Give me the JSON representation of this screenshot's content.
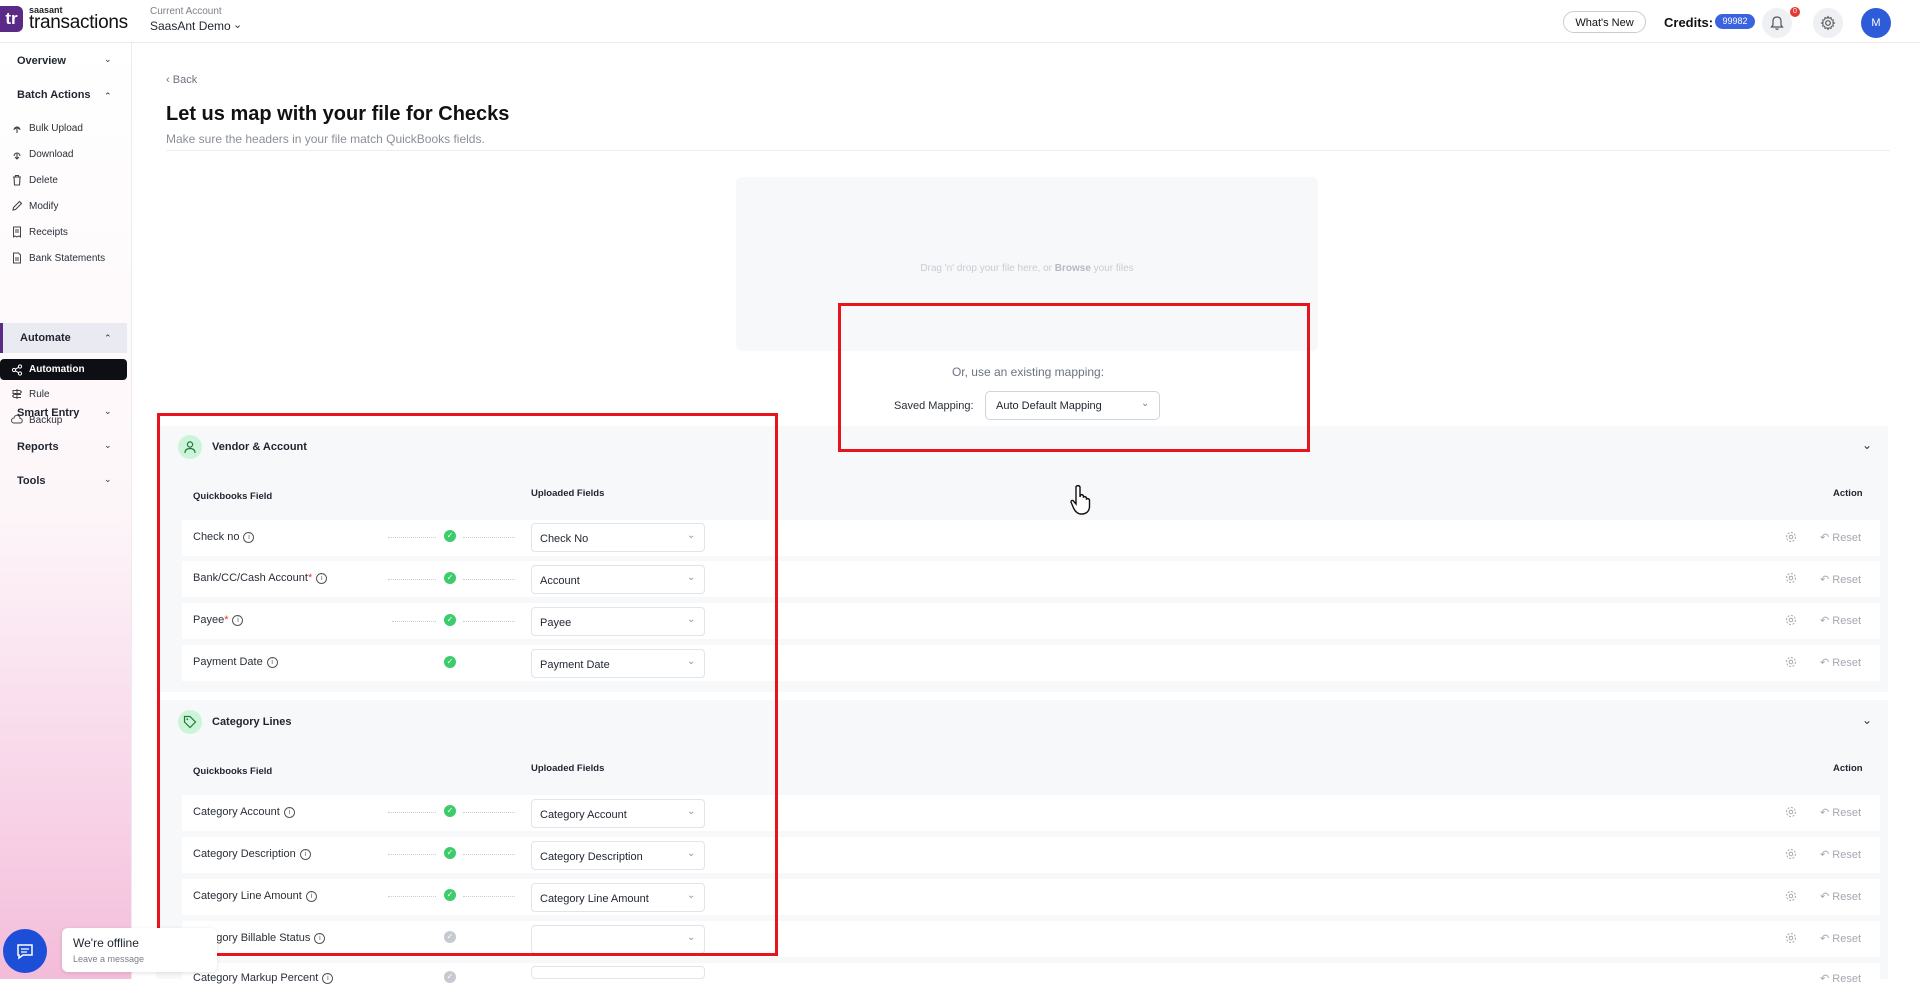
{
  "header": {
    "logo_mark": "tr",
    "logo_small": "saasant",
    "logo_big": "transactions",
    "account_caption": "Current Account",
    "account_name": "SaasAnt Demo",
    "whats_new": "What's New",
    "credits_label": "Credits:",
    "credits_value": "99982",
    "notification_count": "0",
    "avatar_initial": "M"
  },
  "sidebar": {
    "overview": "Overview",
    "batch_actions": "Batch Actions",
    "batch_items": [
      "Bulk Upload",
      "Download",
      "Delete",
      "Modify",
      "Receipts",
      "Bank Statements"
    ],
    "automate": "Automate",
    "automate_items": [
      "Automation",
      "Rule",
      "Backup"
    ],
    "smart_entry": "Smart Entry",
    "reports": "Reports",
    "tools": "Tools"
  },
  "main": {
    "back": "Back",
    "title": "Let us map with your file for Checks",
    "subtitle": "Make sure the headers in your file match QuickBooks fields.",
    "dropzone_before": "Drag 'n' drop your file here, or ",
    "dropzone_browse": "Browse",
    "dropzone_after": " your files",
    "existing_caption": "Or, use an existing mapping:",
    "saved_mapping_label": "Saved Mapping:",
    "saved_mapping_value": "Auto Default Mapping"
  },
  "sections": [
    {
      "title": "Vendor & Account",
      "col_qb": "Quickbooks Field",
      "col_uploaded": "Uploaded Fields",
      "col_action": "Action",
      "rows": [
        {
          "label": "Check no",
          "required": "",
          "value": "Check No",
          "mapped": true
        },
        {
          "label": "Bank/CC/Cash Account",
          "required": "*",
          "value": "Account",
          "mapped": true
        },
        {
          "label": "Payee",
          "required": "*",
          "value": "Payee",
          "mapped": true
        },
        {
          "label": "Payment Date",
          "required": "",
          "value": "Payment Date",
          "mapped": true
        }
      ]
    },
    {
      "title": "Category Lines",
      "col_qb": "Quickbooks Field",
      "col_uploaded": "Uploaded Fields",
      "col_action": "Action",
      "rows": [
        {
          "label": "Category Account",
          "required": "",
          "value": "Category Account",
          "mapped": true
        },
        {
          "label": "Category Description",
          "required": "",
          "value": "Category Description",
          "mapped": true
        },
        {
          "label": "Category Line Amount",
          "required": "",
          "value": "Category Line Amount",
          "mapped": true
        },
        {
          "label": "Category Billable Status",
          "required": "",
          "value": "",
          "mapped": false
        },
        {
          "label": "Category Markup Percent",
          "required": "",
          "value": "",
          "mapped": false
        }
      ]
    }
  ],
  "reset_label": "Reset",
  "chat": {
    "title": "We're offline",
    "subtitle": "Leave a message"
  },
  "colors": {
    "brand": "#5b2a86",
    "accent_blue": "#2e5bd8",
    "mapped_green": "#3ccc6a",
    "highlight_red": "#e8141b"
  }
}
